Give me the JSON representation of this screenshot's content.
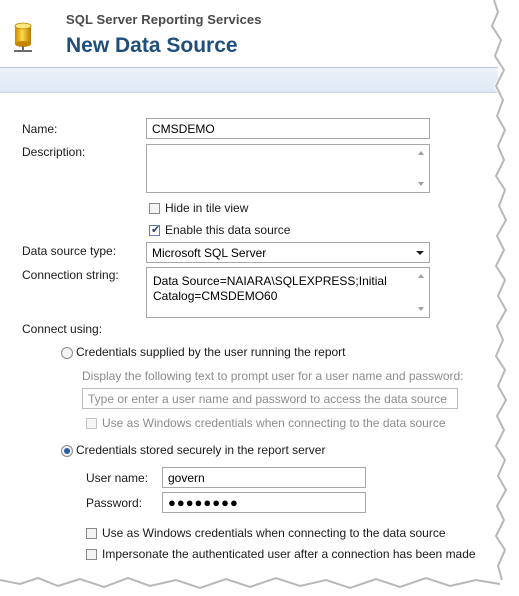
{
  "header": {
    "app_name": "SQL Server Reporting Services",
    "page_title": "New Data Source"
  },
  "form": {
    "name_label": "Name:",
    "name_value": "CMSDEMO",
    "description_label": "Description:",
    "description_value": "",
    "hide_tile_label": "Hide in tile view",
    "hide_tile_checked": false,
    "enable_label": "Enable this data source",
    "enable_checked": true,
    "ds_type_label": "Data source type:",
    "ds_type_value": "Microsoft SQL Server",
    "conn_label": "Connection string:",
    "conn_value": "Data Source=NAIARA\\SQLEXPRESS;Initial Catalog=CMSDEMO60"
  },
  "connect_using": {
    "label": "Connect using:",
    "option_user": {
      "label": "Credentials supplied by the user running the report",
      "selected": false,
      "prompt_label": "Display the following text to prompt user for a user name and password:",
      "prompt_value": "Type or enter a user name and password to access the data source",
      "windows_creds_label": "Use as Windows credentials when connecting to the data source",
      "windows_creds_checked": false
    },
    "option_stored": {
      "label": "Credentials stored securely in the report server",
      "selected": true,
      "username_label": "User name:",
      "username_value": "govern",
      "password_label": "Password:",
      "password_mask": "●●●●●●●●",
      "windows_creds_label": "Use as Windows credentials when connecting to the data source",
      "windows_creds_checked": false,
      "impersonate_label": "Impersonate the authenticated user after a connection has been made",
      "impersonate_checked": false
    }
  },
  "colors": {
    "title": "#1f4f7c",
    "toolbar": "#dfe8f5",
    "radio_selected": "#2a5ea8"
  },
  "icons": {
    "app": "database-cylinder-icon"
  }
}
